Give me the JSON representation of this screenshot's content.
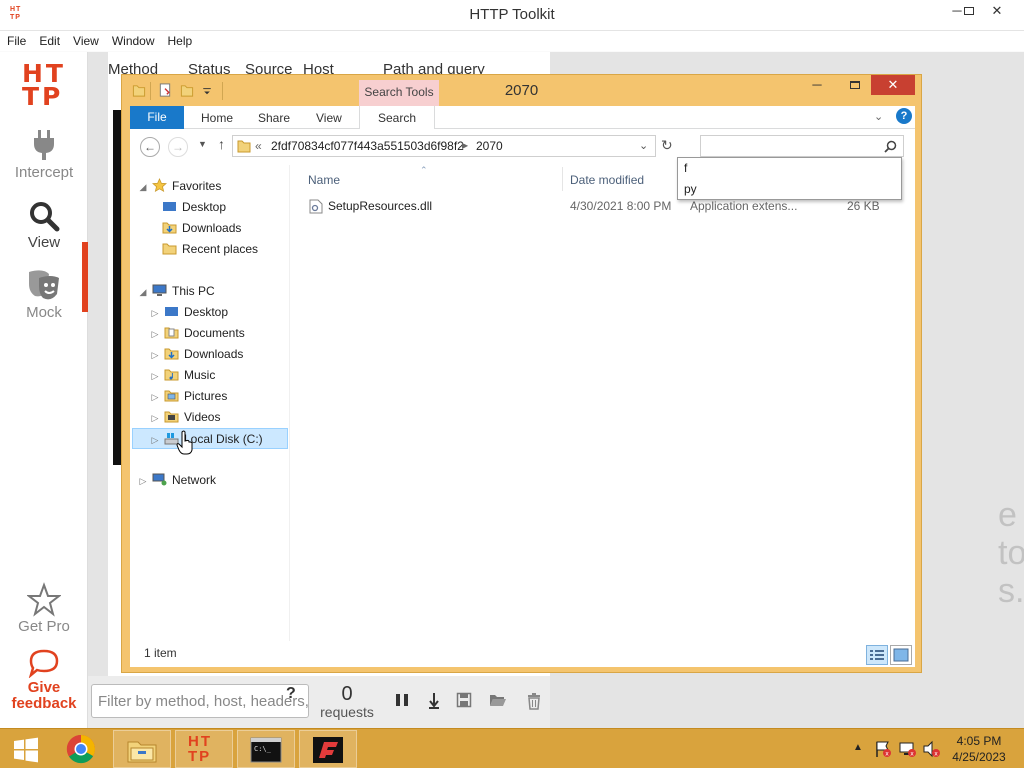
{
  "httptoolkit": {
    "window_title": "HTTP Toolkit",
    "logo_text": "HT TP",
    "menu": [
      "File",
      "Edit",
      "View",
      "Window",
      "Help"
    ],
    "nav": {
      "intercept": "Intercept",
      "view": "View",
      "mock": "Mock",
      "get_pro": "Get Pro",
      "give_feedback_line1": "Give",
      "give_feedback_line2": "feedback"
    },
    "columns": [
      "Method",
      "Status",
      "Source",
      "Host",
      "Path and query"
    ],
    "background_text_line1": "e to",
    "background_text_line2": "s.",
    "filter_placeholder": "Filter by method, host, headers, s",
    "request_count": "0",
    "request_label": "requests",
    "accent_color": "#e1421f"
  },
  "explorer": {
    "title": "2070",
    "contextual_tab": "Search Tools",
    "ribbon_tabs": [
      "File",
      "Home",
      "Share",
      "View",
      "Search"
    ],
    "breadcrumb": {
      "prefix": "«",
      "parent": "2fdf70834cf077f443a551503d6f98f2",
      "current": "2070"
    },
    "search_suggestions": [
      "f",
      "py"
    ],
    "tree": {
      "favorites": "Favorites",
      "favorites_items": [
        "Desktop",
        "Downloads",
        "Recent places"
      ],
      "this_pc": "This PC",
      "this_pc_items": [
        "Desktop",
        "Documents",
        "Downloads",
        "Music",
        "Pictures",
        "Videos",
        "Local Disk (C:)"
      ],
      "network": "Network"
    },
    "columns": {
      "name": "Name",
      "date_modified": "Date modified"
    },
    "files": [
      {
        "name": "SetupResources.dll",
        "date_modified": "4/30/2021 8:00 PM",
        "type": "Application extens...",
        "size": "26 KB"
      }
    ],
    "status_text": "1 item"
  },
  "taskbar": {
    "apps": [
      "start-button",
      "chrome",
      "file-explorer",
      "http-toolkit",
      "command-prompt",
      "flare-app"
    ],
    "clock_time": "4:05 PM",
    "clock_date": "4/25/2023"
  }
}
